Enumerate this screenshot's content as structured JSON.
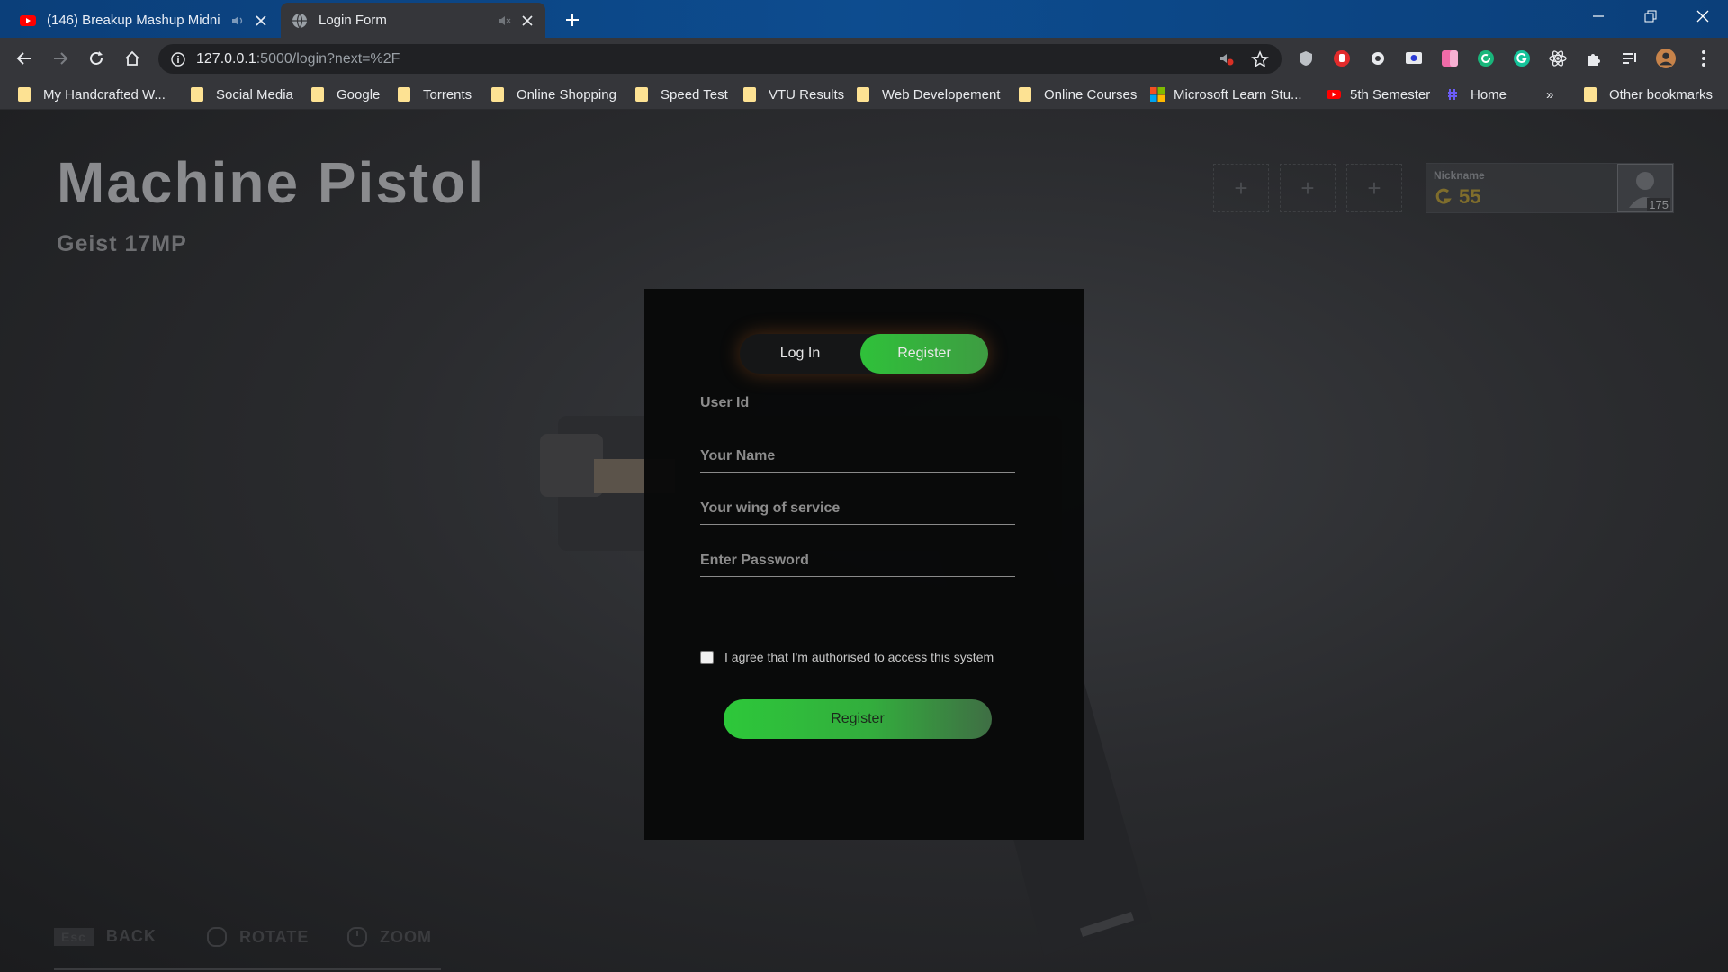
{
  "browser": {
    "tabs": [
      {
        "title": "(146) Breakup Mashup Midni",
        "favicon": "youtube-icon",
        "active": false
      },
      {
        "title": "Login Form",
        "favicon": "globe-icon",
        "active": true
      }
    ],
    "address": {
      "host": "127.0.0.1",
      "rest": ":5000/login?next=%2F"
    },
    "bookmarks": [
      {
        "label": "My Handcrafted W...",
        "icon": "folder-icon"
      },
      {
        "label": "Social Media",
        "icon": "folder-icon"
      },
      {
        "label": "Google",
        "icon": "folder-icon"
      },
      {
        "label": "Torrents",
        "icon": "folder-icon"
      },
      {
        "label": "Online Shopping",
        "icon": "folder-icon"
      },
      {
        "label": "Speed Test",
        "icon": "folder-icon"
      },
      {
        "label": "VTU Results",
        "icon": "folder-icon"
      },
      {
        "label": "Web Developement",
        "icon": "folder-icon"
      },
      {
        "label": "Online Courses",
        "icon": "folder-icon"
      },
      {
        "label": "Microsoft Learn Stu...",
        "icon": "microsoft-icon"
      },
      {
        "label": "5th Semester",
        "icon": "youtube-icon"
      },
      {
        "label": "Home",
        "icon": "hashnode-icon"
      }
    ],
    "overflow": "»",
    "other_bookmarks": "Other bookmarks"
  },
  "game": {
    "title": "Machine Pistol",
    "subtitle": "Geist 17MP",
    "profile": {
      "nickname_label": "Nickname",
      "currency": "55",
      "level": "175"
    },
    "hints": [
      {
        "key": "Esc",
        "label": "BACK"
      },
      {
        "key": "",
        "label": "ROTATE"
      },
      {
        "key": "",
        "label": "ZOOM"
      }
    ]
  },
  "form": {
    "toggle": {
      "login": "Log In",
      "register": "Register",
      "selected": "register"
    },
    "fields": [
      {
        "placeholder": "User Id",
        "value": ""
      },
      {
        "placeholder": "Your Name",
        "value": ""
      },
      {
        "placeholder": "Your wing of service",
        "value": ""
      },
      {
        "placeholder": "Enter Password",
        "value": ""
      }
    ],
    "agree_label": "I agree that I'm authorised to access this system",
    "agree_checked": false,
    "submit_label": "Register"
  },
  "colors": {
    "accent_green": "#2fc13a",
    "tabbar_blue": "#0d4c8f",
    "chrome_gray": "#35363a"
  }
}
